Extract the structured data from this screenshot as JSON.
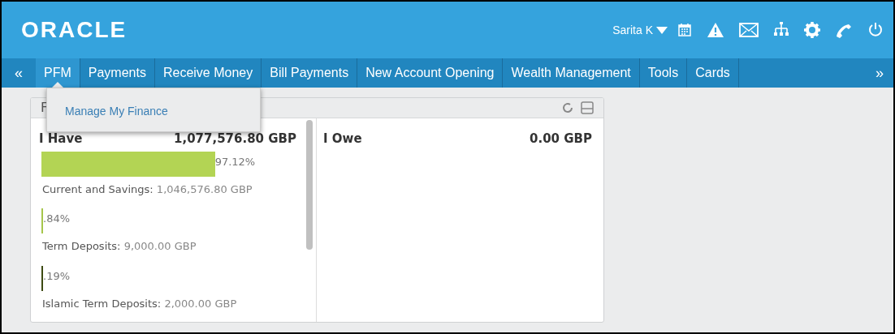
{
  "header": {
    "logo": "ORACLE",
    "user": "Sarita K"
  },
  "nav": {
    "scroll_left": "«",
    "scroll_right": "»",
    "items": [
      {
        "label": "PFM",
        "selected": true
      },
      {
        "label": "Payments",
        "selected": false
      },
      {
        "label": "Receive Money",
        "selected": false
      },
      {
        "label": "Bill Payments",
        "selected": false
      },
      {
        "label": "New Account Opening",
        "selected": false
      },
      {
        "label": "Wealth Management",
        "selected": false
      },
      {
        "label": "Tools",
        "selected": false
      },
      {
        "label": "Cards",
        "selected": false
      }
    ]
  },
  "dropdown": {
    "items": [
      "Manage My Finance"
    ]
  },
  "panel": {
    "title": "F",
    "have": {
      "label": "I Have",
      "total": "1,077,576.80 GBP",
      "items": [
        {
          "percent": "97.12%",
          "color": "#b3d454",
          "name": "Current and Savings:",
          "amount": "1,046,576.80 GBP"
        },
        {
          "percent": ".84%",
          "color": "#a6c64b",
          "name": "Term Deposits:",
          "amount": "9,000.00 GBP"
        },
        {
          "percent": ".19%",
          "color": "#3d4a12",
          "name": "Islamic Term Deposits:",
          "amount": "2,000.00 GBP"
        }
      ]
    },
    "owe": {
      "label": "I Owe",
      "total": "0.00 GBP"
    }
  }
}
